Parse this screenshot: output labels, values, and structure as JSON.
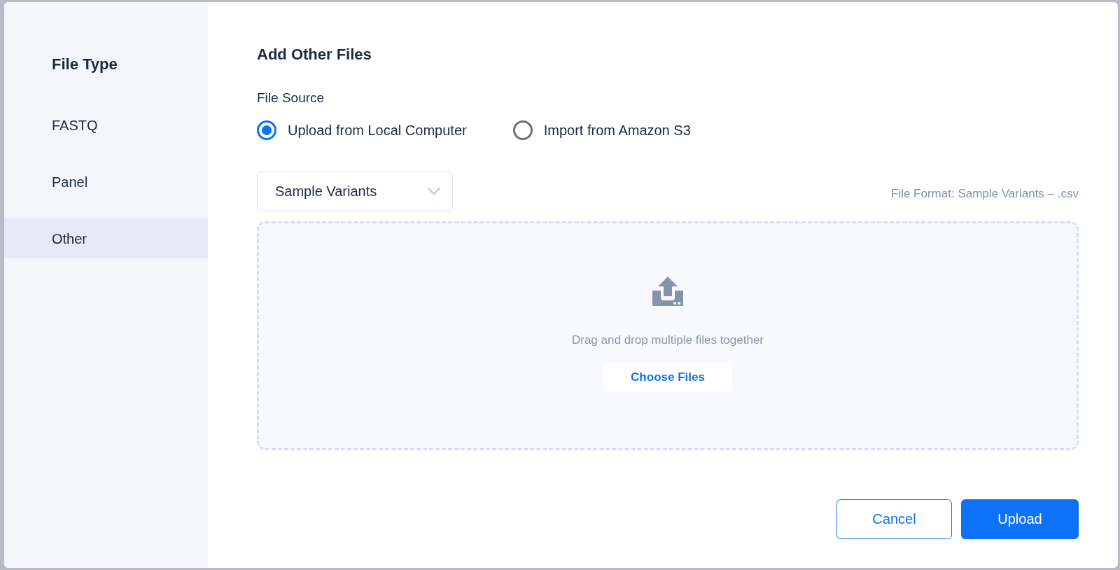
{
  "sidebar": {
    "title": "File Type",
    "items": [
      {
        "label": "FASTQ",
        "selected": false
      },
      {
        "label": "Panel",
        "selected": false
      },
      {
        "label": "Other",
        "selected": true
      }
    ]
  },
  "main": {
    "title": "Add Other Files",
    "file_source": {
      "label": "File Source",
      "options": [
        {
          "label": "Upload from Local Computer",
          "selected": true
        },
        {
          "label": "Import from Amazon S3",
          "selected": false
        }
      ]
    },
    "dropdown": {
      "value": "Sample Variants"
    },
    "file_format": "File Format: Sample Variants – .csv",
    "dropzone": {
      "hint": "Drag and drop multiple files together",
      "button": "Choose Files"
    },
    "buttons": {
      "cancel": "Cancel",
      "upload": "Upload"
    }
  }
}
